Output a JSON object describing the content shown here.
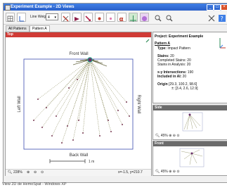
{
  "window": {
    "title": "Experiment Example - 2D Views"
  },
  "toolbar": {
    "line_weight_label": "Line Weight:",
    "line_weight_value": "4"
  },
  "tabs": [
    "All Patterns",
    "Pattern A"
  ],
  "top_view": {
    "header": "Top",
    "walls": {
      "front": "Front Wall",
      "back": "Back Wall",
      "left": "Left Wall",
      "right": "Right Wall"
    },
    "scale_label": "1 m",
    "zoom": "228%",
    "coords": "x=-1.5, y=210.7"
  },
  "project_panel": {
    "title": "Project: Experiment Example",
    "pattern": "Pattern A",
    "type_label": "Type:",
    "type_value": "Impact Pattern",
    "stains_label": "Stains:",
    "stains_value": "20",
    "completed_label": "Completed Stains:",
    "completed_value": "20",
    "in_analysis_label": "Stains in Analysis:",
    "in_analysis_value": "20",
    "intersections_label": "x-y Intersections:",
    "intersections_value": "190",
    "included_label": "Included in AI:",
    "included_value": "20",
    "origin_label": "Origin",
    "origin_value": "[29.3, 100.2, 98.6]",
    "uncertainty_label": "±:",
    "uncertainty_value": "[3.4, 2.6, 12.9]"
  },
  "side_view": {
    "header": "Side",
    "zoom": "45%"
  },
  "front_view": {
    "header": "Front",
    "zoom": "45%"
  },
  "status_caption": "View 2D de HemoSpat - Windows XP",
  "colors": {
    "top_header": "#d03b36",
    "side_header": "#6b6b6b",
    "title_bar": "#2a5fc8",
    "trajectory": "#8a8a5a",
    "stain": "#7a3b55"
  }
}
